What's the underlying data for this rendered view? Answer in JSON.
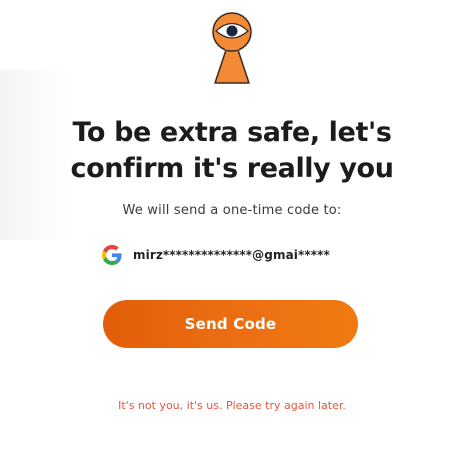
{
  "hero": {
    "icon": "keyhole-eye-icon",
    "colors": {
      "fill": "#f28a36",
      "outline": "#3a2a20",
      "eye_white": "#ffffff",
      "pupil": "#1a2540"
    }
  },
  "heading": {
    "line1": "To be extra safe, let's",
    "line2": "confirm it's really you"
  },
  "subtitle": "We will send a one-time code to:",
  "account": {
    "provider_icon": "google-icon",
    "email": "mirz**************@gmai*****"
  },
  "send_button": {
    "label": "Send Code",
    "color_start": "#e35d0a",
    "color_end": "#f07a10"
  },
  "error_message": {
    "text": "It's not you, it's us. Please try again later.",
    "color": "#e8543c"
  }
}
